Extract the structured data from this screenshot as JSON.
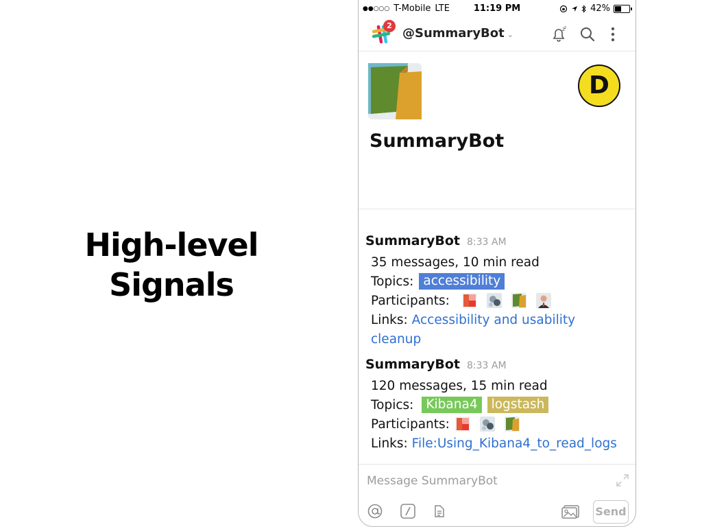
{
  "slide": {
    "title_line1": "High-level",
    "title_line2": "Signals"
  },
  "status_bar": {
    "carrier": "T-Mobile",
    "network": "LTE",
    "time": "11:19 PM",
    "battery_percent": "42%",
    "signal_dots": "●●○○○"
  },
  "app_bar": {
    "notification_count": "2",
    "channel_name": "@SummaryBot",
    "chevron": "⌄",
    "icons": [
      "slack-logo-icon",
      "snooze-bell-icon",
      "search-icon",
      "more-vertical-icon"
    ]
  },
  "profile": {
    "name": "SummaryBot",
    "avatar_letter": "D"
  },
  "messages": [
    {
      "author": "SummaryBot",
      "time": "8:33 AM",
      "summary": "35 messages, 10 min read",
      "topics_label": "Topics:",
      "topics": [
        {
          "label": "accessibility",
          "color": "#4f7fd6"
        }
      ],
      "participants_label": "Participants:",
      "participant_count": 4,
      "links_label": "Links:",
      "link_text_1": "Accessibility and usability",
      "link_text_2": "cleanup"
    },
    {
      "author": "SummaryBot",
      "time": "8:33 AM",
      "summary": "120 messages, 15 min read",
      "topics_label": "Topics:",
      "topics": [
        {
          "label": "Kibana4",
          "color": "#77c95a"
        },
        {
          "label": "logstash",
          "color": "#cbb85c"
        }
      ],
      "participants_label": "Participants:",
      "participant_count": 3,
      "links_label": "Links:",
      "link_text_1": "File:Using_Kibana4_to_read_logs"
    }
  ],
  "composer": {
    "placeholder_prefix": "Message",
    "placeholder_target": "SummaryBot",
    "send_label": "Send",
    "icons": [
      "at-mention-icon",
      "slash-command-icon",
      "snippet-icon",
      "photo-upload-icon",
      "expand-icon"
    ]
  },
  "colors": {
    "link": "#2e6fd1",
    "badge": "#e0393e",
    "avatar_bg": "#f4dd1f"
  }
}
